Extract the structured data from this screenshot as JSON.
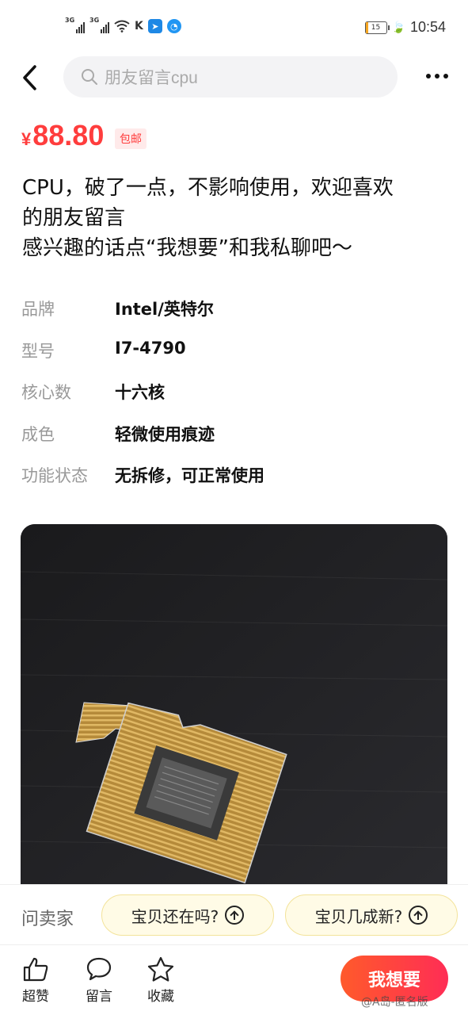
{
  "status_bar": {
    "network1": "3G",
    "network2": "3G",
    "battery": "15",
    "time": "10:54",
    "icons": [
      "signal-icon",
      "signal-icon",
      "wifi-icon",
      "k-app-icon",
      "send-app-icon",
      "chat-app-icon",
      "battery-icon",
      "leaf-icon"
    ]
  },
  "header": {
    "search_placeholder": "朋友留言cpu"
  },
  "listing": {
    "currency": "¥",
    "price": "88.80",
    "shipping_badge": "包邮",
    "description_lines": [
      "CPU，破了一点，不影响使用，欢迎喜欢",
      "的朋友留言",
      "感兴趣的话点“我想要”和我私聊吧～"
    ],
    "attributes": [
      {
        "key": "品牌",
        "value": "Intel/英特尔"
      },
      {
        "key": "型号",
        "value": "I7-4790"
      },
      {
        "key": "核心数",
        "value": "十六核"
      },
      {
        "key": "成色",
        "value": "轻微使用痕迹"
      },
      {
        "key": "功能状态",
        "value": "无拆修，可正常使用"
      }
    ]
  },
  "ask_bar": {
    "label": "问卖家",
    "chips": [
      "宝贝还在吗?",
      "宝贝几成新?"
    ]
  },
  "bottom_bar": {
    "like_label": "超赞",
    "comment_label": "留言",
    "favorite_label": "收藏",
    "want_label": "我想要"
  },
  "watermark": "@A岛-匿名版",
  "colors": {
    "price_red": "#ff3d3d",
    "chip_bg": "#fffbe6",
    "want_gradient_start": "#ff5a2b",
    "want_gradient_end": "#ff2d55"
  }
}
